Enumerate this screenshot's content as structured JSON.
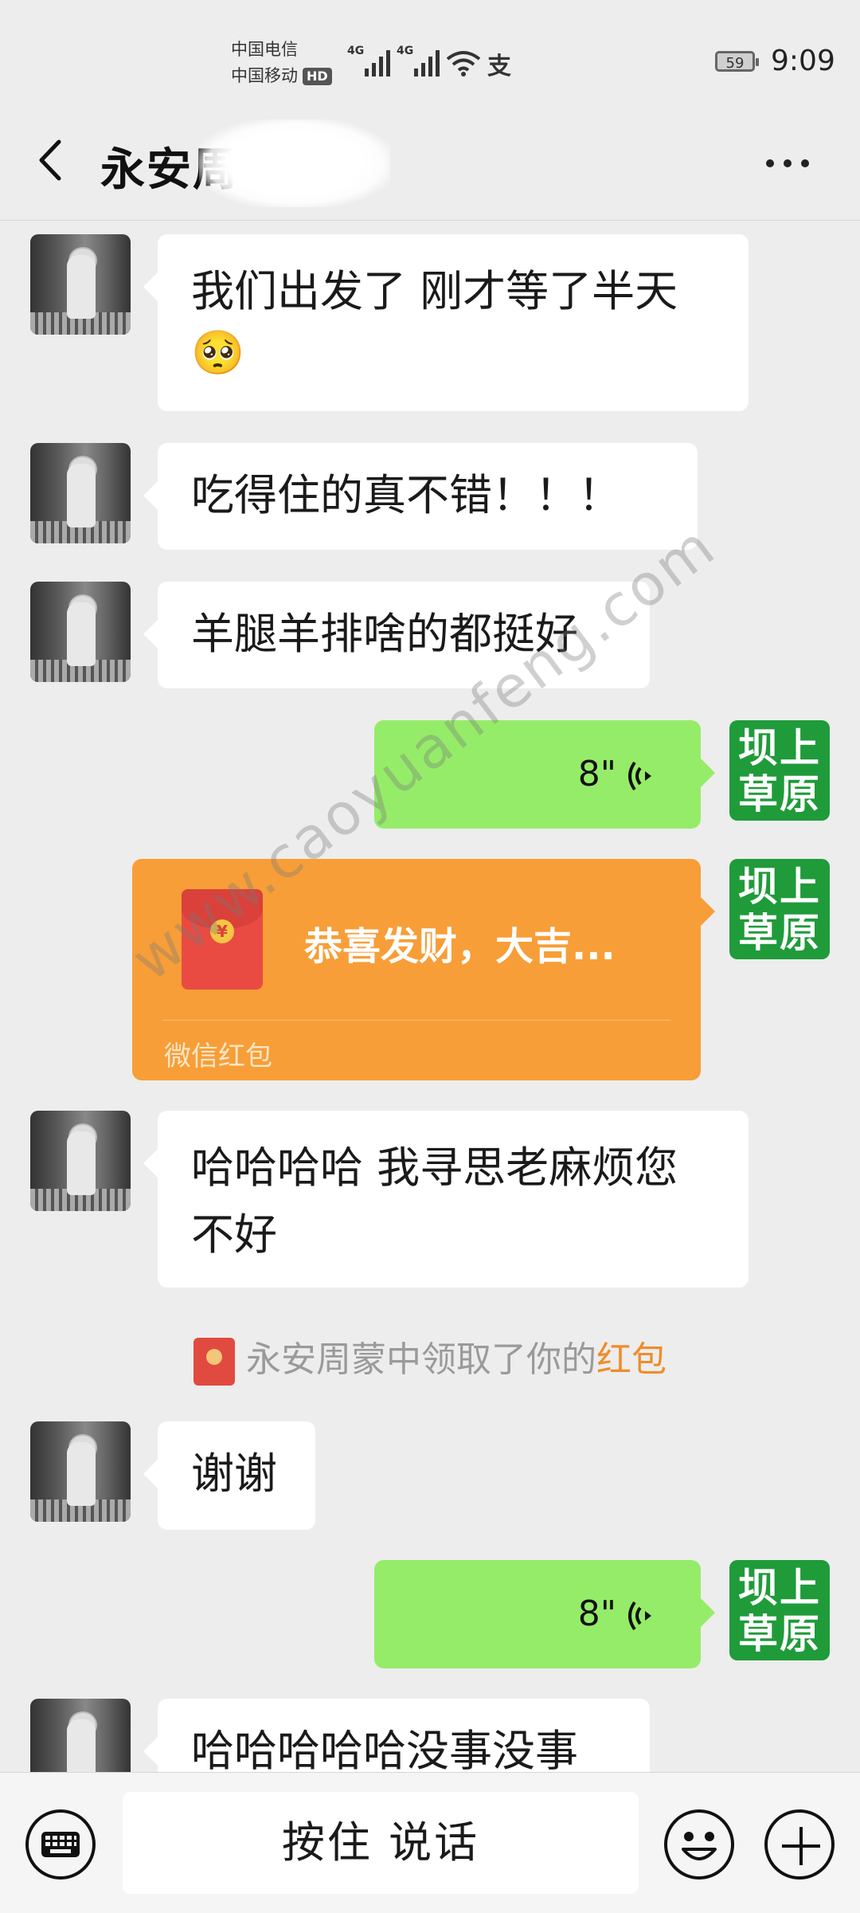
{
  "status_bar": {
    "carrier_1": "中国电信",
    "carrier_2": "中国移动",
    "hd_badge": "HD",
    "network_1": "4G",
    "network_2": "4G",
    "pay_icon_glyph": "支",
    "battery": "59",
    "time": "9:09"
  },
  "header": {
    "title": "永安周",
    "back_icon": "chevron-left-icon",
    "more_icon": "more-dots-icon"
  },
  "messages": [
    {
      "side": "left",
      "type": "text",
      "text_line1": "我们出发了 刚才等了半天",
      "emoji": "🥺"
    },
    {
      "side": "left",
      "type": "text",
      "text": "吃得住的真不错！！！"
    },
    {
      "side": "left",
      "type": "text",
      "text": "羊腿羊排啥的都挺好"
    },
    {
      "side": "right",
      "type": "voice",
      "duration": "8\""
    },
    {
      "side": "right",
      "type": "red_packet",
      "greeting": "恭喜发财，大吉...",
      "label": "微信红包",
      "coin": "¥"
    },
    {
      "side": "left",
      "type": "text",
      "text_line1": "哈哈哈哈 我寻思老麻烦您",
      "text_line2": "不好"
    },
    {
      "type": "system",
      "prefix": "永安周蒙中领取了你的",
      "link": "红包"
    },
    {
      "side": "left",
      "type": "text",
      "text": "谢谢"
    },
    {
      "side": "right",
      "type": "voice",
      "duration": "8\""
    },
    {
      "side": "left",
      "type": "text",
      "text": "哈哈哈哈哈没事没事"
    }
  ],
  "self_avatar": {
    "line1": "坝上",
    "line2": "草原"
  },
  "watermark": "www.caoyuanfeng.com",
  "bottom_bar": {
    "voice_input_label": "按住 说话",
    "keyboard_icon": "keyboard-icon",
    "emoji_icon": "emoji-icon",
    "plus_icon": "plus-icon"
  },
  "colors": {
    "background": "#ededed",
    "bubble_self": "#95ec69",
    "bubble_other": "#ffffff",
    "red_packet": "#f79e38",
    "self_avatar": "#1f9b3a",
    "system_link": "#f08c2a"
  }
}
